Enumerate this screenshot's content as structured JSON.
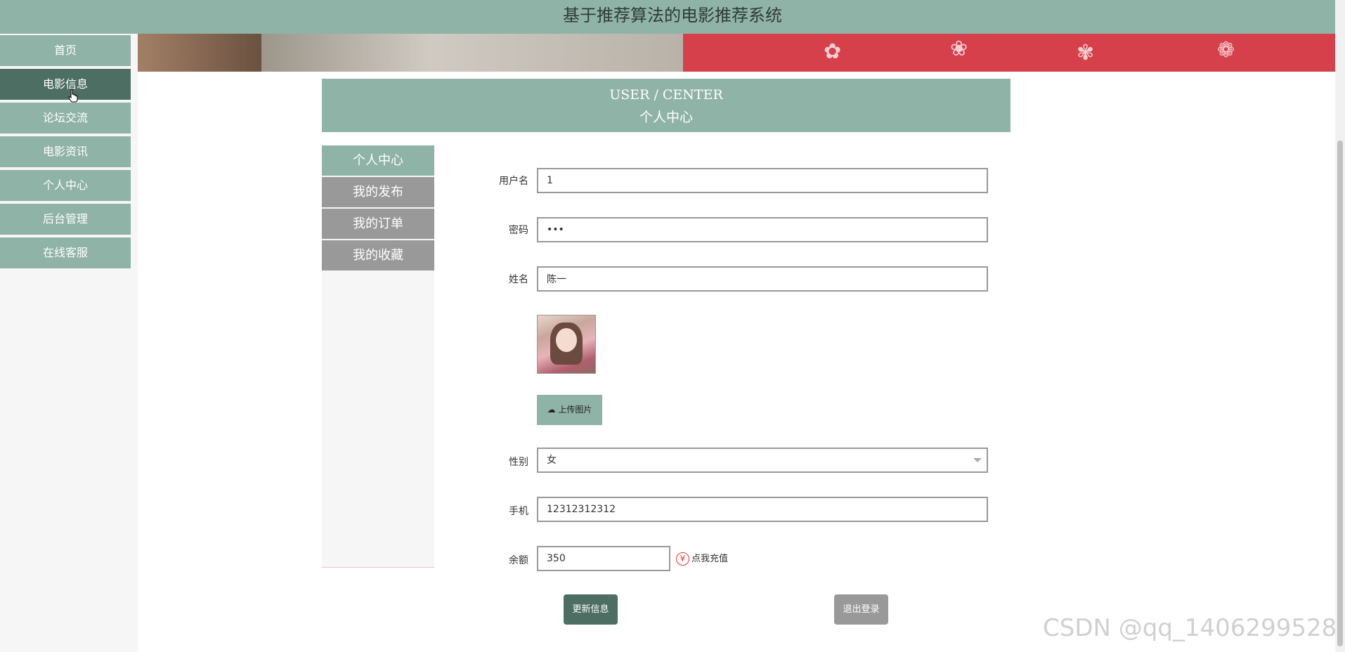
{
  "header": {
    "title": "基于推荐算法的电影推荐系统"
  },
  "sidebar": {
    "items": [
      {
        "label": "首页"
      },
      {
        "label": "电影信息"
      },
      {
        "label": "论坛交流"
      },
      {
        "label": "电影资讯"
      },
      {
        "label": "个人中心"
      },
      {
        "label": "后台管理"
      },
      {
        "label": "在线客服"
      }
    ],
    "active": "电影信息"
  },
  "user_center": {
    "title_en": "USER / CENTER",
    "title_cn": "个人中心",
    "nav": [
      {
        "label": "个人中心"
      },
      {
        "label": "我的发布"
      },
      {
        "label": "我的订单"
      },
      {
        "label": "我的收藏"
      }
    ],
    "active_nav": "个人中心"
  },
  "form": {
    "username": {
      "label": "用户名",
      "value": "1"
    },
    "password": {
      "label": "密码",
      "value": "•••"
    },
    "name": {
      "label": "姓名",
      "value": "陈一"
    },
    "upload_label": "上传图片",
    "gender": {
      "label": "性别",
      "value": "女"
    },
    "phone": {
      "label": "手机",
      "value": "12312312312"
    },
    "balance": {
      "label": "余额",
      "value": "350"
    },
    "recharge_label": "点我充值",
    "recharge_icon": "¥",
    "update_label": "更新信息",
    "logout_label": "退出登录"
  },
  "watermark": "CSDN @qq_1406299528",
  "colors": {
    "accent": "#8fb3a6",
    "active": "#4d6e63",
    "gray": "#999999"
  }
}
